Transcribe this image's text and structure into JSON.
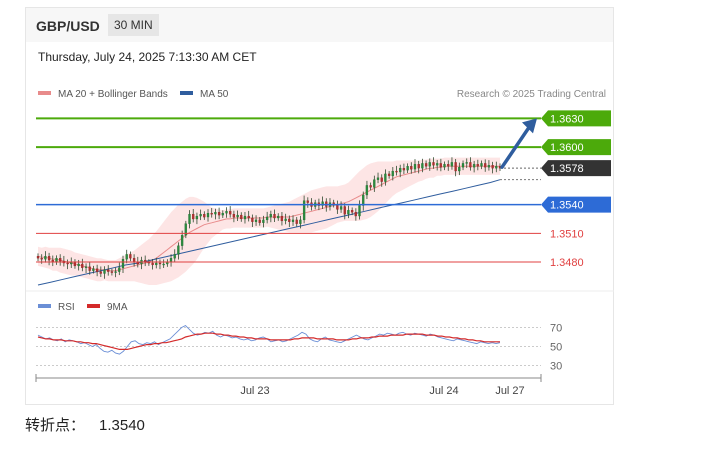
{
  "header": {
    "symbol": "GBP/USD",
    "timeframe": "30 MIN",
    "timestamp": "Thursday, July 24, 2025 7:13:30 AM CET"
  },
  "legend": {
    "ma20": "MA 20 + Bollinger Bands",
    "ma50": "MA 50",
    "credit": "Research © 2025 Trading Central",
    "rsi": "RSI",
    "ma9": "9MA"
  },
  "colors": {
    "up": "#2b8a3e",
    "green_level": "#4caa0b",
    "blue_level": "#2d6bd6",
    "red_level": "#e04040",
    "ma20": "#e88b8b",
    "ma50": "#2f5d9e",
    "band_fill": "#fde0e0",
    "rsi": "#6b8fd6",
    "ma9": "#d42a2a"
  },
  "chart_data": [
    {
      "type": "candlestick",
      "title": "GBP/USD 30 MIN",
      "x_labels": [
        "Jul 23",
        "Jul 24",
        "Jul 27"
      ],
      "ylim": [
        1.3455,
        1.3645
      ],
      "levels": [
        {
          "label": "1.3630",
          "value": 1.363,
          "kind": "resistance"
        },
        {
          "label": "1.3600",
          "value": 1.36,
          "kind": "resistance"
        },
        {
          "label": "1.3578",
          "value": 1.3578,
          "kind": "last-price"
        },
        {
          "label": "1.3540",
          "value": 1.354,
          "kind": "pivot"
        },
        {
          "label": "1.3510",
          "value": 1.351,
          "kind": "support"
        },
        {
          "label": "1.3480",
          "value": 1.348,
          "kind": "support"
        }
      ],
      "close": [
        1.3484,
        1.3483,
        1.3486,
        1.3482,
        1.348,
        1.3484,
        1.3481,
        1.3479,
        1.3478,
        1.348,
        1.3476,
        1.3478,
        1.3474,
        1.3475,
        1.3471,
        1.3473,
        1.347,
        1.3468,
        1.3472,
        1.347,
        1.3469,
        1.347,
        1.3474,
        1.3483,
        1.3488,
        1.3484,
        1.348,
        1.3478,
        1.3482,
        1.348,
        1.3479,
        1.3477,
        1.3479,
        1.3478,
        1.3478,
        1.348,
        1.3484,
        1.3488,
        1.3497,
        1.3508,
        1.352,
        1.353,
        1.3525,
        1.3528,
        1.353,
        1.3527,
        1.3531,
        1.353,
        1.3532,
        1.3529,
        1.3531,
        1.3533,
        1.353,
        1.3527,
        1.3529,
        1.3525,
        1.3528,
        1.3526,
        1.3522,
        1.3524,
        1.3521,
        1.3524,
        1.3527,
        1.353,
        1.3526,
        1.3528,
        1.3523,
        1.3525,
        1.3522,
        1.3524,
        1.352,
        1.3524,
        1.3544,
        1.3542,
        1.3538,
        1.3542,
        1.3539,
        1.3543,
        1.3538,
        1.3542,
        1.354,
        1.3535,
        1.3538,
        1.353,
        1.3534,
        1.3532,
        1.3528,
        1.3539,
        1.355,
        1.356,
        1.3558,
        1.3566,
        1.3568,
        1.3564,
        1.3572,
        1.357,
        1.3575,
        1.3574,
        1.3578,
        1.3576,
        1.358,
        1.3577,
        1.3582,
        1.3578,
        1.3583,
        1.358,
        1.3584,
        1.3581,
        1.3583,
        1.3579,
        1.3582,
        1.358,
        1.3584,
        1.3575,
        1.3579,
        1.3583,
        1.3584,
        1.3579,
        1.3582,
        1.358,
        1.3583,
        1.3579,
        1.3581,
        1.3578,
        1.358,
        1.3578
      ],
      "ma20": [
        1.3486,
        1.3485,
        1.3485,
        1.3484,
        1.3483,
        1.3483,
        1.3482,
        1.3481,
        1.348,
        1.3479,
        1.3478,
        1.3477,
        1.3476,
        1.3475,
        1.3474,
        1.3473,
        1.3472,
        1.3472,
        1.3472,
        1.3471,
        1.3471,
        1.3471,
        1.3472,
        1.3473,
        1.3474,
        1.3475,
        1.3476,
        1.3477,
        1.3478,
        1.3479,
        1.348,
        1.3482,
        1.3484,
        1.3487,
        1.349,
        1.3493,
        1.3496,
        1.3499,
        1.3502,
        1.3505,
        1.3508,
        1.3511,
        1.3513,
        1.3515,
        1.3517,
        1.3519,
        1.352,
        1.3521,
        1.3522,
        1.3523,
        1.3524,
        1.3525,
        1.3525,
        1.3526,
        1.3526,
        1.3526,
        1.3526,
        1.3526,
        1.3526,
        1.3526,
        1.3526,
        1.3526,
        1.3527,
        1.3527,
        1.3527,
        1.3527,
        1.3527,
        1.3527,
        1.3527,
        1.3528,
        1.3529,
        1.353,
        1.3531,
        1.3532,
        1.3533,
        1.3534,
        1.3535,
        1.3536,
        1.3537,
        1.3538,
        1.3539,
        1.354,
        1.3541,
        1.3542,
        1.3543,
        1.3545,
        1.3547,
        1.3549,
        1.3551,
        1.3553,
        1.3555,
        1.3557,
        1.3559,
        1.3561,
        1.3563,
        1.3565,
        1.3567,
        1.3569,
        1.357,
        1.3571,
        1.3572,
        1.3573,
        1.3574,
        1.3575,
        1.3576,
        1.3577,
        1.3578,
        1.3578,
        1.3579,
        1.3579,
        1.358,
        1.358,
        1.358,
        1.358,
        1.358,
        1.358,
        1.358,
        1.358,
        1.358,
        1.358,
        1.358,
        1.358,
        1.358,
        1.358,
        1.358,
        1.358
      ],
      "band_width": [
        0.001,
        0.001,
        0.0011,
        0.0011,
        0.0012,
        0.0012,
        0.0013,
        0.0013,
        0.0013,
        0.0013,
        0.0012,
        0.0012,
        0.0012,
        0.0012,
        0.0012,
        0.0012,
        0.0012,
        0.0012,
        0.0011,
        0.0011,
        0.0011,
        0.0011,
        0.0012,
        0.0013,
        0.0014,
        0.0015,
        0.0016,
        0.0018,
        0.002,
        0.0022,
        0.0024,
        0.0026,
        0.0028,
        0.003,
        0.0032,
        0.0034,
        0.0036,
        0.0037,
        0.0038,
        0.0038,
        0.0038,
        0.0037,
        0.0035,
        0.0032,
        0.0028,
        0.0024,
        0.002,
        0.0016,
        0.0014,
        0.0012,
        0.001,
        0.001,
        0.001,
        0.001,
        0.001,
        0.001,
        0.001,
        0.001,
        0.001,
        0.001,
        0.001,
        0.001,
        0.001,
        0.0011,
        0.0012,
        0.0013,
        0.0014,
        0.0015,
        0.0016,
        0.0017,
        0.0018,
        0.0019,
        0.002,
        0.0021,
        0.0022,
        0.0022,
        0.0022,
        0.0022,
        0.0022,
        0.0021,
        0.002,
        0.0019,
        0.0019,
        0.0019,
        0.002,
        0.0022,
        0.0024,
        0.0026,
        0.0027,
        0.0028,
        0.0028,
        0.0027,
        0.0026,
        0.0024,
        0.0022,
        0.002,
        0.0018,
        0.0017,
        0.0016,
        0.0015,
        0.0014,
        0.0013,
        0.0012,
        0.0011,
        0.0011,
        0.001,
        0.001,
        0.001,
        0.0009,
        0.0009,
        0.0009,
        0.0009,
        0.0009,
        0.0009,
        0.0009,
        0.0009,
        0.0009,
        0.0009,
        0.0009,
        0.0009,
        0.0009,
        0.0009,
        0.0009,
        0.0009,
        0.0009,
        0.0009
      ],
      "ma50": [
        1.3456,
        1.3459,
        1.3462,
        1.3465,
        1.3468,
        1.3471,
        1.3474,
        1.3477,
        1.3479,
        1.3482,
        1.3485,
        1.3488,
        1.3491,
        1.3494,
        1.3497,
        1.35,
        1.3503,
        1.3506,
        1.3509,
        1.3512,
        1.3515,
        1.3518,
        1.3521,
        1.3524,
        1.3527,
        1.353,
        1.3533,
        1.3536,
        1.3539,
        1.3542,
        1.3545,
        1.3548,
        1.3551,
        1.3554,
        1.3557,
        1.356,
        1.3563,
        1.3566
      ],
      "ma50_start_index": 0,
      "ma50_step": 3.4,
      "projection": {
        "from": 1.3578,
        "to": 1.363
      }
    },
    {
      "type": "line",
      "title": "RSI",
      "ylim": [
        20,
        80
      ],
      "ticks": [
        70,
        50,
        30
      ],
      "series": [
        {
          "name": "RSI",
          "values": [
            62,
            60,
            58,
            59,
            57,
            56,
            58,
            55,
            57,
            56,
            55,
            53,
            54,
            52,
            50,
            52,
            48,
            45,
            44,
            46,
            43,
            42,
            45,
            50,
            55,
            56,
            53,
            52,
            54,
            53,
            55,
            52,
            54,
            56,
            58,
            62,
            66,
            70,
            72,
            68,
            64,
            62,
            63,
            65,
            64,
            66,
            62,
            60,
            62,
            61,
            59,
            60,
            58,
            57,
            58,
            56,
            57,
            59,
            60,
            58,
            55,
            56,
            57,
            55,
            56,
            58,
            60,
            62,
            65,
            63,
            58,
            56,
            55,
            58,
            60,
            57,
            56,
            55,
            54,
            56,
            58,
            60,
            62,
            60,
            58,
            57,
            59,
            61,
            63,
            62,
            64,
            63,
            62,
            64,
            65,
            63,
            62,
            64,
            63,
            62,
            61,
            63,
            62,
            60,
            59,
            58,
            57,
            56,
            58,
            57,
            56,
            55,
            54,
            53,
            55,
            54,
            53,
            54,
            53,
            54
          ]
        },
        {
          "name": "9MA",
          "values": [
            60,
            59,
            58,
            58,
            57,
            57,
            57,
            56,
            56,
            56,
            55,
            55,
            54,
            54,
            53,
            53,
            52,
            51,
            50,
            49,
            48,
            47,
            47,
            47,
            48,
            49,
            50,
            51,
            52,
            52,
            53,
            53,
            54,
            54,
            55,
            56,
            57,
            58,
            60,
            61,
            62,
            63,
            63,
            64,
            64,
            64,
            63,
            63,
            62,
            62,
            61,
            61,
            60,
            60,
            59,
            59,
            58,
            58,
            58,
            58,
            57,
            57,
            57,
            57,
            57,
            57,
            58,
            58,
            59,
            59,
            59,
            59,
            58,
            58,
            58,
            58,
            58,
            57,
            57,
            57,
            57,
            58,
            58,
            59,
            59,
            59,
            60,
            60,
            61,
            61,
            61,
            62,
            62,
            62,
            62,
            63,
            63,
            63,
            63,
            63,
            62,
            62,
            62,
            61,
            61,
            60,
            60,
            59,
            59,
            58,
            58,
            57,
            57,
            56,
            56,
            55,
            55,
            55,
            55,
            55
          ]
        }
      ]
    }
  ],
  "footer": {
    "label": "转折点：",
    "value": "1.3540"
  }
}
